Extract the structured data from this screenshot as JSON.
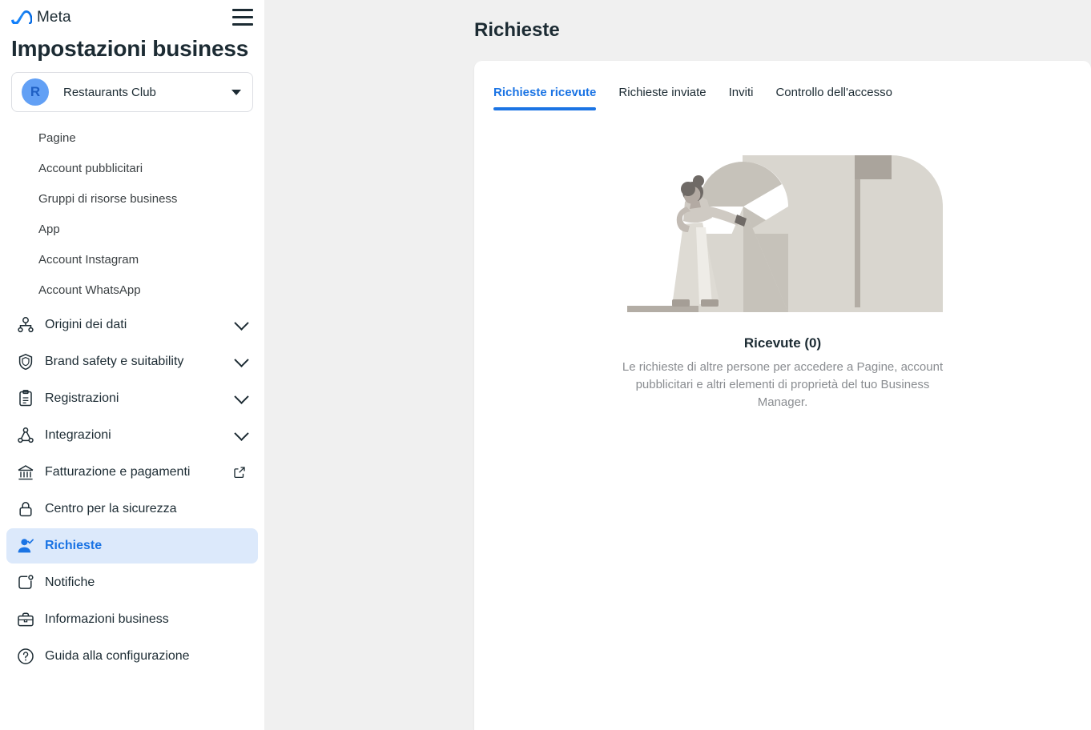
{
  "brand": {
    "logo_icon": "meta-infinity-icon",
    "wordmark": "Meta"
  },
  "sidebar": {
    "menu_icon": "hamburger-menu-icon",
    "title": "Impostazioni business",
    "business_selector": {
      "avatar_initial": "R",
      "name": "Restaurants Club",
      "caret_icon": "caret-down-icon"
    },
    "sub_items": [
      {
        "label": "Pagine"
      },
      {
        "label": "Account pubblicitari"
      },
      {
        "label": "Gruppi di risorse business"
      },
      {
        "label": "App"
      },
      {
        "label": "Account Instagram"
      },
      {
        "label": "Account WhatsApp"
      }
    ],
    "sections": [
      {
        "label": "Origini dei dati",
        "icon": "data-sources-icon",
        "trailing": "chevron-down-icon"
      },
      {
        "label": "Brand safety e suitability",
        "icon": "shield-icon",
        "trailing": "chevron-down-icon"
      },
      {
        "label": "Registrazioni",
        "icon": "clipboard-icon",
        "trailing": "chevron-down-icon"
      },
      {
        "label": "Integrazioni",
        "icon": "integrations-icon",
        "trailing": "chevron-down-icon"
      },
      {
        "label": "Fatturazione e pagamenti",
        "icon": "bank-icon",
        "trailing": "external-link-icon"
      },
      {
        "label": "Centro per la sicurezza",
        "icon": "lock-icon",
        "trailing": "none"
      },
      {
        "label": "Richieste",
        "icon": "person-check-icon",
        "trailing": "none",
        "active": true
      },
      {
        "label": "Notifiche",
        "icon": "bell-icon",
        "trailing": "none"
      },
      {
        "label": "Informazioni business",
        "icon": "briefcase-icon",
        "trailing": "none"
      },
      {
        "label": "Guida alla configurazione",
        "icon": "question-circle-icon",
        "trailing": "none"
      }
    ]
  },
  "main": {
    "page_title": "Richieste",
    "tabs": [
      {
        "label": "Richieste ricevute",
        "active": true
      },
      {
        "label": "Richieste inviate",
        "active": false
      },
      {
        "label": "Inviti",
        "active": false
      },
      {
        "label": "Controllo dell'accesso",
        "active": false
      }
    ],
    "empty_state": {
      "illustration": "mailbox-person-illustration",
      "title": "Ricevute (0)",
      "description": "Le richieste di altre persone per accedere a Pagine, account pubblicitari e altri elementi di proprietà del tuo Business Manager."
    }
  },
  "colors": {
    "accent_blue": "#1b74e4",
    "active_nav_bg": "#dce9fb",
    "avatar_bg": "#62a0f5",
    "text_primary": "#1c2b33",
    "text_muted": "#8a8d91",
    "page_bg": "#f0f0f0",
    "illustration_light": "#d9d6cf",
    "illustration_mid": "#c6c2ba",
    "illustration_dark": "#aaa49c"
  }
}
